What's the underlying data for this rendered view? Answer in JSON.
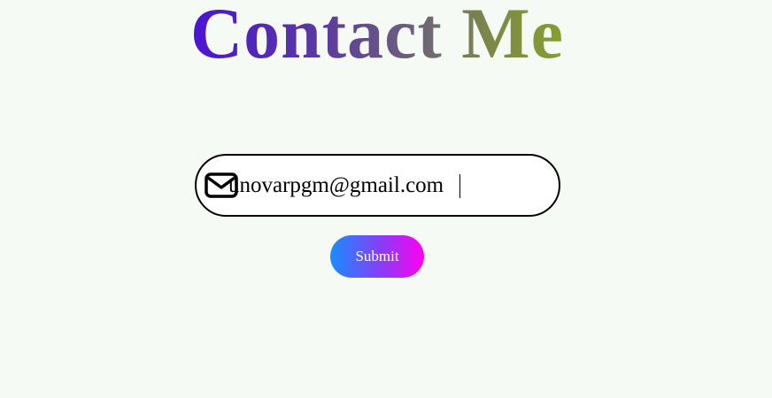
{
  "page": {
    "title": "Contact Me"
  },
  "form": {
    "email_value": "unovarpgm@gmail.com",
    "email_icon": "envelope-icon",
    "submit_label": "Submit"
  },
  "colors": {
    "background": "#f5faf5",
    "title_gradient_start": "#4c12d6",
    "title_gradient_end": "#84a02c",
    "button_gradient_start": "#1a8cff",
    "button_gradient_end": "#ff00f0",
    "button_text": "#ffffff"
  }
}
